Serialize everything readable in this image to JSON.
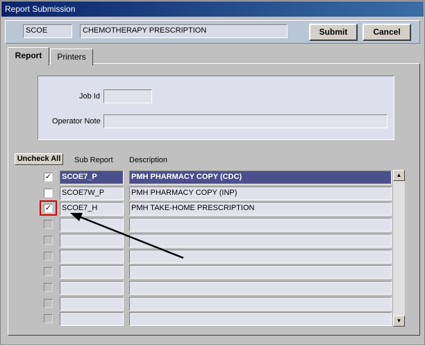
{
  "window": {
    "title": "Report Submission"
  },
  "header": {
    "code": "SCOE",
    "name": "CHEMOTHERAPY PRESCRIPTION"
  },
  "buttons": {
    "submit": "Submit",
    "cancel": "Cancel",
    "uncheck_all": "Uncheck All"
  },
  "tabs": [
    {
      "label": "Report"
    },
    {
      "label": "Printers"
    }
  ],
  "job": {
    "job_id_label": "Job Id",
    "job_id_value": "",
    "operator_note_label": "Operator Note",
    "operator_note_value": ""
  },
  "grid": {
    "col_sub_report": "Sub Report",
    "col_description": "Description",
    "rows": [
      {
        "checked": true,
        "sub_report": "SCOE7_P",
        "description": "PMH PHARMACY COPY (CDC)",
        "selected": true
      },
      {
        "checked": false,
        "sub_report": "SCOE7W_P",
        "description": "PMH PHARMACY COPY (INP)",
        "selected": false
      },
      {
        "checked": true,
        "sub_report": "SCOE7_H",
        "description": "PMH TAKE-HOME PRESCRIPTION",
        "selected": false
      },
      {
        "checked": false,
        "sub_report": "",
        "description": "",
        "selected": false
      },
      {
        "checked": false,
        "sub_report": "",
        "description": "",
        "selected": false
      },
      {
        "checked": false,
        "sub_report": "",
        "description": "",
        "selected": false
      },
      {
        "checked": false,
        "sub_report": "",
        "description": "",
        "selected": false
      },
      {
        "checked": false,
        "sub_report": "",
        "description": "",
        "selected": false
      },
      {
        "checked": false,
        "sub_report": "",
        "description": "",
        "selected": false
      },
      {
        "checked": false,
        "sub_report": "",
        "description": "",
        "selected": false
      }
    ]
  },
  "scrollbar": {
    "up_icon": "triangle-up-icon",
    "down_icon": "triangle-down-icon"
  },
  "colors": {
    "selected_row": "#4b4f8c",
    "highlight": "#d00000"
  }
}
